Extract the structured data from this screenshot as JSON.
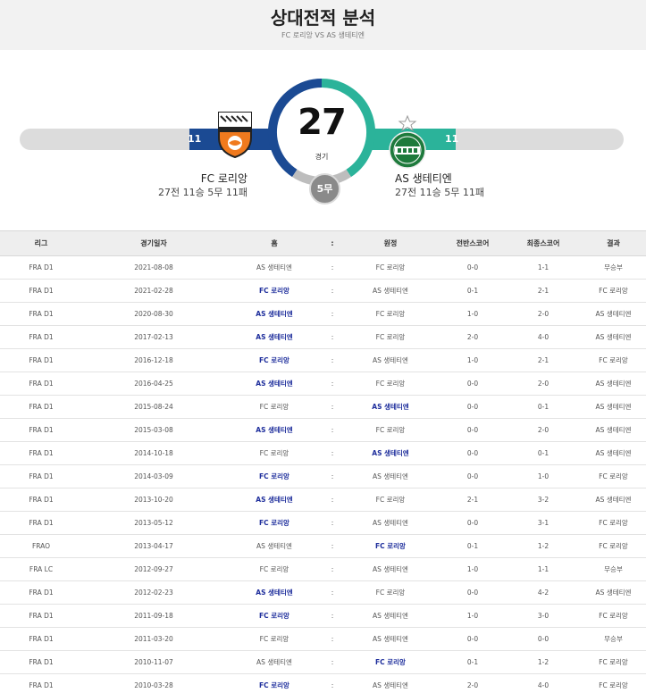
{
  "header": {
    "title": "상대전적 분석",
    "subtitle": "FC 로리앙 VS AS 생테티엔"
  },
  "summary": {
    "total": "27",
    "total_unit": "경기",
    "draws": "5무",
    "home": {
      "name": "FC 로리앙",
      "record": "27전 11승 5무 11패",
      "wins": "11",
      "logo_text": "FC LORIENT"
    },
    "away": {
      "name": "AS 생테티엔",
      "record": "27전 11승 5무 11패",
      "wins": "11",
      "logo_text": "ASSE"
    },
    "colors": {
      "home": "#1b4a93",
      "away": "#2bb39a",
      "bar_bg": "#dcdcdc",
      "draw": "#8a8a8a"
    },
    "home_share": 0.4074,
    "away_share": 0.4074
  },
  "table": {
    "headers": [
      "리그",
      "경기일자",
      "홈",
      ":",
      "원정",
      "전반스코어",
      "최종스코어",
      "결과"
    ],
    "rows": [
      {
        "league": "FRA D1",
        "date": "2021-08-08",
        "home": "AS 생테티엔",
        "sep": ":",
        "away": "FC 로리앙",
        "half": "0-0",
        "final": "1-1",
        "result": "무승부",
        "win": ""
      },
      {
        "league": "FRA D1",
        "date": "2021-02-28",
        "home": "FC 로리앙",
        "sep": ":",
        "away": "AS 생테티엔",
        "half": "0-1",
        "final": "2-1",
        "result": "FC 로리앙",
        "win": "home"
      },
      {
        "league": "FRA D1",
        "date": "2020-08-30",
        "home": "AS 생테티엔",
        "sep": ":",
        "away": "FC 로리앙",
        "half": "1-0",
        "final": "2-0",
        "result": "AS 생테티엔",
        "win": "home"
      },
      {
        "league": "FRA D1",
        "date": "2017-02-13",
        "home": "AS 생테티엔",
        "sep": ":",
        "away": "FC 로리앙",
        "half": "2-0",
        "final": "4-0",
        "result": "AS 생테티엔",
        "win": "home"
      },
      {
        "league": "FRA D1",
        "date": "2016-12-18",
        "home": "FC 로리앙",
        "sep": ":",
        "away": "AS 생테티엔",
        "half": "1-0",
        "final": "2-1",
        "result": "FC 로리앙",
        "win": "home"
      },
      {
        "league": "FRA D1",
        "date": "2016-04-25",
        "home": "AS 생테티엔",
        "sep": ":",
        "away": "FC 로리앙",
        "half": "0-0",
        "final": "2-0",
        "result": "AS 생테티엔",
        "win": "home"
      },
      {
        "league": "FRA D1",
        "date": "2015-08-24",
        "home": "FC 로리앙",
        "sep": ":",
        "away": "AS 생테티엔",
        "half": "0-0",
        "final": "0-1",
        "result": "AS 생테티엔",
        "win": "away"
      },
      {
        "league": "FRA D1",
        "date": "2015-03-08",
        "home": "AS 생테티엔",
        "sep": ":",
        "away": "FC 로리앙",
        "half": "0-0",
        "final": "2-0",
        "result": "AS 생테티엔",
        "win": "home"
      },
      {
        "league": "FRA D1",
        "date": "2014-10-18",
        "home": "FC 로리앙",
        "sep": ":",
        "away": "AS 생테티엔",
        "half": "0-0",
        "final": "0-1",
        "result": "AS 생테티엔",
        "win": "away"
      },
      {
        "league": "FRA D1",
        "date": "2014-03-09",
        "home": "FC 로리앙",
        "sep": ":",
        "away": "AS 생테티엔",
        "half": "0-0",
        "final": "1-0",
        "result": "FC 로리앙",
        "win": "home"
      },
      {
        "league": "FRA D1",
        "date": "2013-10-20",
        "home": "AS 생테티엔",
        "sep": ":",
        "away": "FC 로리앙",
        "half": "2-1",
        "final": "3-2",
        "result": "AS 생테티엔",
        "win": "home"
      },
      {
        "league": "FRA D1",
        "date": "2013-05-12",
        "home": "FC 로리앙",
        "sep": ":",
        "away": "AS 생테티엔",
        "half": "0-0",
        "final": "3-1",
        "result": "FC 로리앙",
        "win": "home"
      },
      {
        "league": "FRAO",
        "date": "2013-04-17",
        "home": "AS 생테티엔",
        "sep": ":",
        "away": "FC 로리앙",
        "half": "0-1",
        "final": "1-2",
        "result": "FC 로리앙",
        "win": "away"
      },
      {
        "league": "FRA LC",
        "date": "2012-09-27",
        "home": "FC 로리앙",
        "sep": ":",
        "away": "AS 생테티엔",
        "half": "1-0",
        "final": "1-1",
        "result": "무승부",
        "win": ""
      },
      {
        "league": "FRA D1",
        "date": "2012-02-23",
        "home": "AS 생테티엔",
        "sep": ":",
        "away": "FC 로리앙",
        "half": "0-0",
        "final": "4-2",
        "result": "AS 생테티엔",
        "win": "home"
      },
      {
        "league": "FRA D1",
        "date": "2011-09-18",
        "home": "FC 로리앙",
        "sep": ":",
        "away": "AS 생테티엔",
        "half": "1-0",
        "final": "3-0",
        "result": "FC 로리앙",
        "win": "home"
      },
      {
        "league": "FRA D1",
        "date": "2011-03-20",
        "home": "FC 로리앙",
        "sep": ":",
        "away": "AS 생테티엔",
        "half": "0-0",
        "final": "0-0",
        "result": "무승부",
        "win": ""
      },
      {
        "league": "FRA D1",
        "date": "2010-11-07",
        "home": "AS 생테티엔",
        "sep": ":",
        "away": "FC 로리앙",
        "half": "0-1",
        "final": "1-2",
        "result": "FC 로리앙",
        "win": "away"
      },
      {
        "league": "FRA D1",
        "date": "2010-03-28",
        "home": "FC 로리앙",
        "sep": ":",
        "away": "AS 생테티엔",
        "half": "2-0",
        "final": "4-0",
        "result": "FC 로리앙",
        "win": "home"
      }
    ]
  }
}
